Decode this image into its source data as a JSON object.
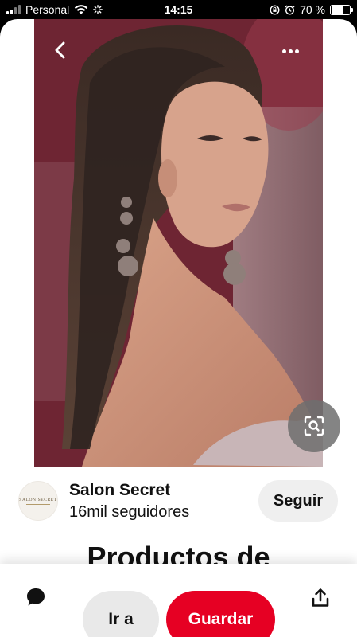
{
  "status_bar": {
    "carrier": "Personal",
    "time": "14:15",
    "battery": "70 %",
    "battery_level": 0.7
  },
  "pin": {
    "image_icon": "portrait-photo",
    "back_icon": "chevron-left-icon",
    "more_icon": "more-dots-icon",
    "lens_icon": "visual-search-icon"
  },
  "creator": {
    "name": "Salon Secret",
    "followers": "16mil seguidores",
    "logo_text": "SALON SECRET",
    "follow_label": "Seguir"
  },
  "title": "Productos de",
  "actions": {
    "visit_label": "Ir a",
    "save_label": "Guardar",
    "comment_icon": "comment-bubble-icon",
    "share_icon": "share-upload-icon"
  },
  "colors": {
    "save": "#e60023",
    "follow": "#efefef",
    "visit": "#e9e9e9"
  }
}
